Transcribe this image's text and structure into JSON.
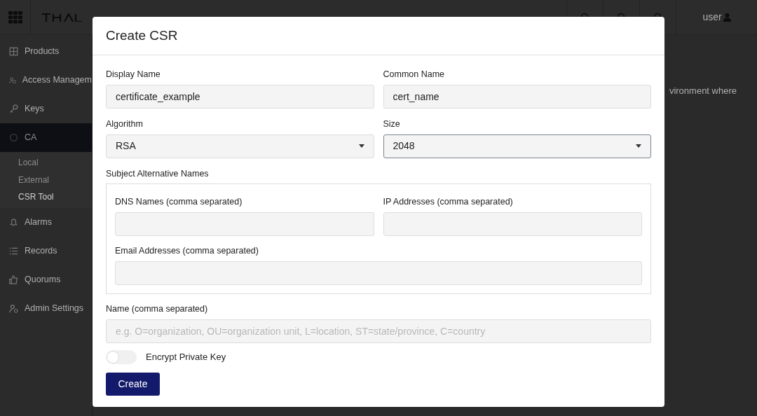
{
  "header": {
    "user": "user"
  },
  "sidebar": {
    "items": [
      {
        "label": "Products",
        "selected": false
      },
      {
        "label": "Access Managem",
        "selected": false
      },
      {
        "label": "Keys",
        "selected": false
      },
      {
        "label": "CA",
        "selected": true,
        "children": [
          {
            "label": "Local",
            "selected": false
          },
          {
            "label": "External",
            "selected": false
          },
          {
            "label": "CSR Tool",
            "selected": true
          }
        ]
      },
      {
        "label": "Alarms",
        "selected": false
      },
      {
        "label": "Records",
        "selected": false
      },
      {
        "label": "Quorums",
        "selected": false
      },
      {
        "label": "Admin Settings",
        "selected": false
      }
    ]
  },
  "background_text": "vironment where",
  "dialog": {
    "title": "Create CSR",
    "display_name": {
      "label": "Display Name",
      "value": "certificate_example"
    },
    "common_name": {
      "label": "Common Name",
      "value": "cert_name"
    },
    "algorithm": {
      "label": "Algorithm",
      "value": "RSA",
      "focused": false
    },
    "size": {
      "label": "Size",
      "value": "2048",
      "focused": true
    },
    "san": {
      "legend": "Subject Alternative Names",
      "dns": {
        "label": "DNS Names (comma separated)"
      },
      "ip": {
        "label": "IP Addresses (comma separated)"
      },
      "email": {
        "label": "Email Addresses (comma separated)"
      }
    },
    "name": {
      "label": "Name (comma separated)",
      "placeholder": "e.g. O=organization, OU=organization unit, L=location, ST=state/province, C=country"
    },
    "encrypt": {
      "label": "Encrypt Private Key",
      "on": false
    },
    "create_button": "Create"
  }
}
